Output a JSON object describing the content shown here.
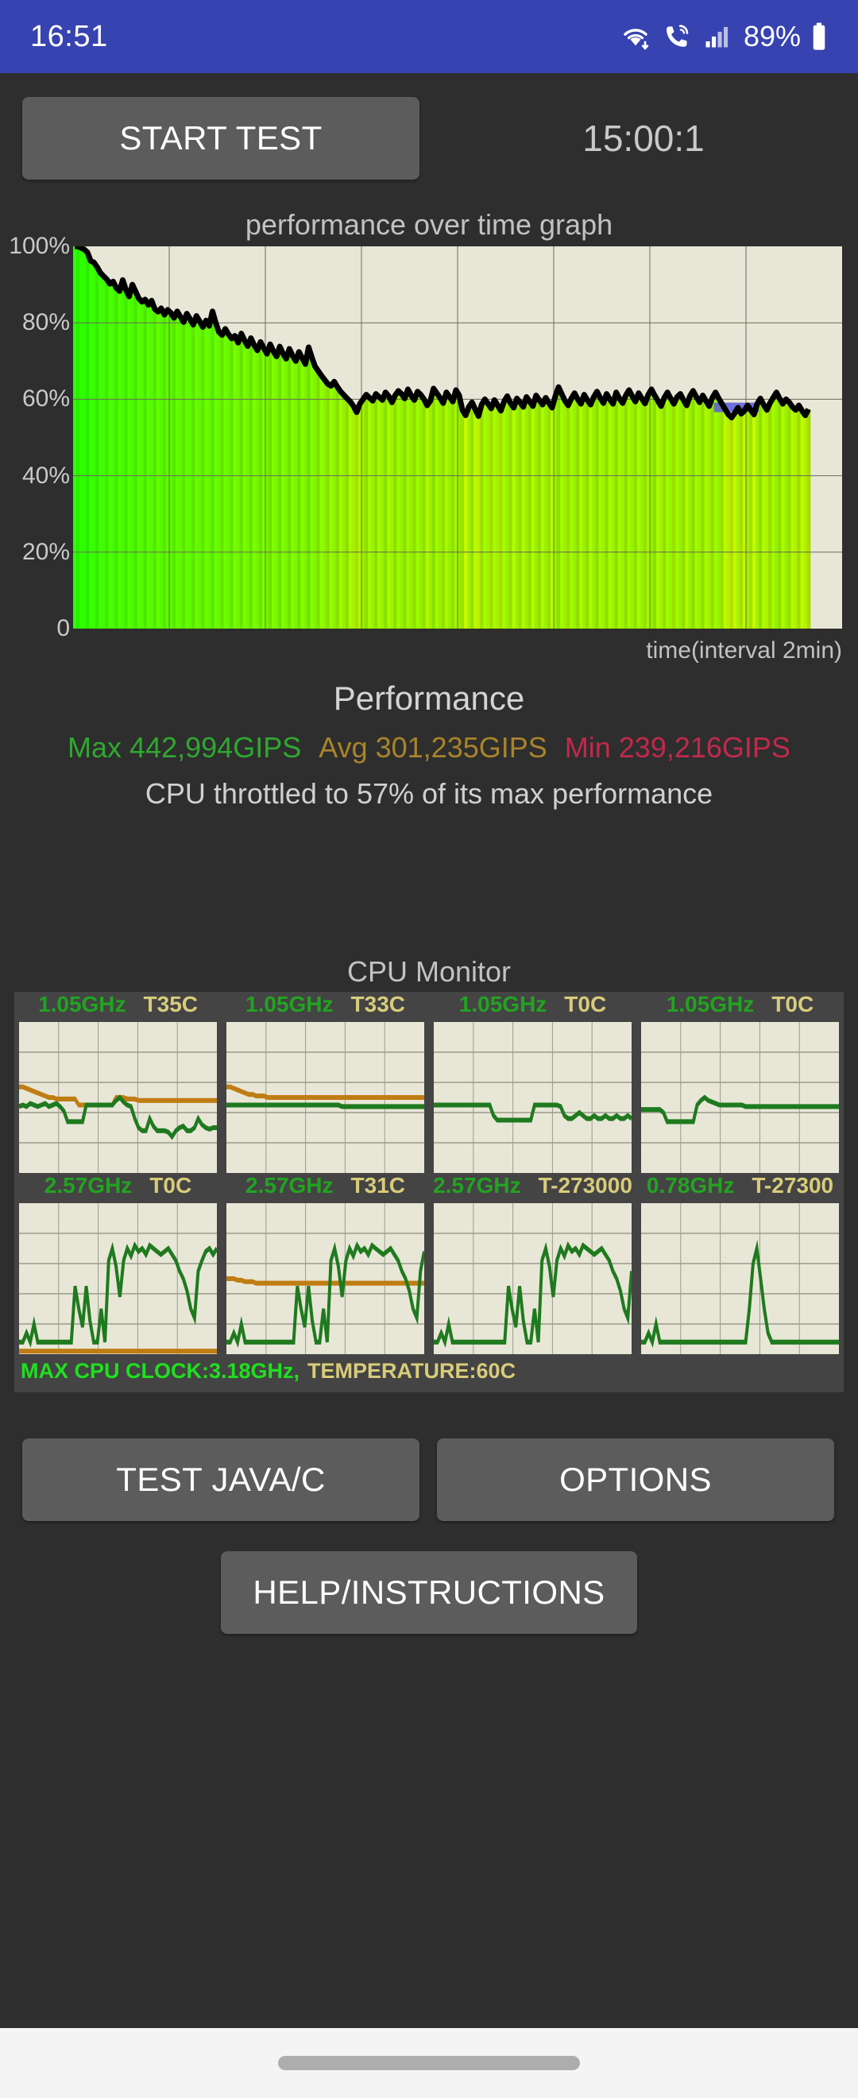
{
  "statusbar": {
    "time": "16:51",
    "battery_percent": "89%",
    "icons": [
      "wifi-icon",
      "call-signal-icon",
      "cellular-signal-icon",
      "battery-icon"
    ]
  },
  "toolbar": {
    "start_test_label": "START TEST",
    "timer": "15:00:1"
  },
  "main_chart": {
    "title": "performance over time graph",
    "xlabel": "time(interval 2min)",
    "yticks": [
      "100%",
      "80%",
      "60%",
      "40%",
      "20%",
      "0"
    ]
  },
  "performance": {
    "title": "Performance",
    "max_label": "Max 442,994GIPS",
    "avg_label": "Avg 301,235GIPS",
    "min_label": "Min 239,216GIPS",
    "max_color": "#2fa82f",
    "avg_color": "#a8842a",
    "min_color": "#c2294b",
    "throttle_text": "CPU throttled to 57% of its max performance"
  },
  "cpu_monitor": {
    "title": "CPU Monitor",
    "cells": [
      {
        "clock": "1.05GHz",
        "temp": "T35C"
      },
      {
        "clock": "1.05GHz",
        "temp": "T33C"
      },
      {
        "clock": "1.05GHz",
        "temp": "T0C"
      },
      {
        "clock": "1.05GHz",
        "temp": "T0C"
      },
      {
        "clock": "2.57GHz",
        "temp": "T0C"
      },
      {
        "clock": "2.57GHz",
        "temp": "T31C"
      },
      {
        "clock": "2.57GHz",
        "temp": "T-273000"
      },
      {
        "clock": "0.78GHz",
        "temp": "T-27300"
      }
    ],
    "footer_clock": "MAX CPU CLOCK:3.18GHz,",
    "footer_temp": "TEMPERATURE:60C"
  },
  "buttons": {
    "test_java_c": "TEST JAVA/C",
    "options": "OPTIONS",
    "help": "HELP/INSTRUCTIONS"
  },
  "navbar": {
    "gesture_pill": "home-gesture-pill"
  },
  "chart_data": {
    "type": "area",
    "title": "performance over time graph",
    "xlabel": "time(interval 2min)",
    "ylabel": "",
    "ylim": [
      0,
      100
    ],
    "grid": true,
    "legend": "none",
    "x_interval_minutes": 2,
    "units": "percent of max performance",
    "fill_gradient_stops": [
      {
        "pct": 0,
        "color": "#2bff00"
      },
      {
        "pct": 40,
        "color": "#9bf000"
      },
      {
        "pct": 52,
        "color": "#f5ee00"
      },
      {
        "pct": 58,
        "color": "#ff9000"
      },
      {
        "pct": 100,
        "color": "#ff3d00"
      }
    ],
    "line_color": "#000000",
    "highlight_color": "#5b5bdd",
    "values": [
      100,
      100,
      99.6,
      99.2,
      98.4,
      96.2,
      95.8,
      94.6,
      93.1,
      92.2,
      91.4,
      90.2,
      90.8,
      89.1,
      88.3,
      91.2,
      88.6,
      86.9,
      90.0,
      88.2,
      86.4,
      85.5,
      86.1,
      84.7,
      85.8,
      83.6,
      82.9,
      83.8,
      82.1,
      83.4,
      82.6,
      81.3,
      83.0,
      81.6,
      80.2,
      82.4,
      81.0,
      79.5,
      81.8,
      80.4,
      78.9,
      80.6,
      79.2,
      83.0,
      80.1,
      77.6,
      76.8,
      78.4,
      77.0,
      75.9,
      76.6,
      74.8,
      77.2,
      75.4,
      73.9,
      76.0,
      74.2,
      72.8,
      75.0,
      73.4,
      71.9,
      74.4,
      72.6,
      71.2,
      73.8,
      72.0,
      70.6,
      73.2,
      71.4,
      70.0,
      72.4,
      70.8,
      69.2,
      73.6,
      71.0,
      68.6,
      67.4,
      66.2,
      65.1,
      64.0,
      63.5,
      64.6,
      63.2,
      62.0,
      61.1,
      60.2,
      59.4,
      58.2,
      56.6,
      58.8,
      60.0,
      61.2,
      60.4,
      59.6,
      61.4,
      60.6,
      59.8,
      61.8,
      60.8,
      59.2,
      61.0,
      62.2,
      61.4,
      60.2,
      62.6,
      61.0,
      59.8,
      62.0,
      61.2,
      60.0,
      58.4,
      59.6,
      62.8,
      61.6,
      60.4,
      59.0,
      61.8,
      60.6,
      59.4,
      62.4,
      61.0,
      57.2,
      55.8,
      58.0,
      59.2,
      57.4,
      55.6,
      58.6,
      60.0,
      58.8,
      57.6,
      59.8,
      58.4,
      57.0,
      59.4,
      60.8,
      59.0,
      57.8,
      60.2,
      59.2,
      58.0,
      60.6,
      59.4,
      58.2,
      61.0,
      59.8,
      58.6,
      60.4,
      59.0,
      57.8,
      60.8,
      63.2,
      61.4,
      59.6,
      58.4,
      60.2,
      61.6,
      60.0,
      58.8,
      61.2,
      59.8,
      58.6,
      60.6,
      62.0,
      60.4,
      59.0,
      61.4,
      60.0,
      58.8,
      61.8,
      60.2,
      59.0,
      61.0,
      62.4,
      60.8,
      59.4,
      61.6,
      60.2,
      58.9,
      61.2,
      62.6,
      61.0,
      59.6,
      58.2,
      60.4,
      61.8,
      60.2,
      58.8,
      60.6,
      61.4,
      59.8,
      58.4,
      60.8,
      62.2,
      60.6,
      59.2,
      61.0,
      59.6,
      58.2,
      60.4,
      61.8,
      60.2,
      58.8,
      57.4,
      56.0,
      55.2,
      56.4,
      57.8,
      56.2,
      57.0,
      58.4,
      57.2,
      56.0,
      58.8,
      60.2,
      58.6,
      57.2,
      59.0,
      60.4,
      61.8,
      60.2,
      58.8,
      60.0,
      59.2,
      58.0,
      57.2,
      58.4,
      57.0,
      55.8,
      57.4
    ],
    "highlight_range": [
      200,
      214
    ],
    "highlight_value": 58.5
  },
  "cpu_mini_charts": [
    {
      "clock_series": [
        44,
        45,
        44,
        46,
        45,
        44,
        45,
        46,
        44,
        45,
        46,
        44,
        41,
        34,
        34,
        34,
        34,
        34,
        45,
        45,
        45,
        45,
        45,
        45,
        45,
        45,
        48,
        50,
        47,
        45,
        44,
        36,
        30,
        28,
        28,
        36,
        31,
        28,
        28,
        28,
        27,
        24,
        28,
        30,
        31,
        28,
        28,
        30,
        36,
        32,
        30,
        29,
        30,
        30
      ],
      "temp_series": [
        57,
        57,
        56,
        55,
        54,
        53,
        52,
        51,
        50,
        50,
        49,
        49,
        49,
        49,
        49,
        49,
        45,
        45,
        45,
        45,
        45,
        45,
        45,
        45,
        45,
        45,
        50,
        50,
        50,
        49,
        49,
        49,
        48,
        48,
        48,
        48,
        48,
        48,
        48,
        48,
        48,
        48,
        48,
        48,
        48,
        48,
        48,
        48,
        48,
        48,
        48,
        48,
        48,
        48
      ]
    },
    {
      "clock_series": [
        45,
        45,
        45,
        45,
        45,
        45,
        45,
        45,
        45,
        45,
        45,
        45,
        45,
        45,
        45,
        45,
        45,
        45,
        45,
        45,
        45,
        45,
        45,
        45,
        45,
        45,
        45,
        45,
        45,
        45,
        45,
        44,
        44,
        44,
        44,
        44,
        44,
        44,
        44,
        44,
        44,
        44,
        44,
        44,
        44,
        44,
        44,
        44,
        44,
        44,
        44,
        44,
        44,
        44
      ],
      "temp_series": [
        57,
        57,
        56,
        55,
        54,
        53,
        52,
        52,
        51,
        51,
        51,
        50,
        50,
        50,
        50,
        50,
        50,
        50,
        50,
        50,
        50,
        50,
        50,
        50,
        50,
        50,
        50,
        50,
        50,
        50,
        50,
        50,
        50,
        50,
        50,
        50,
        50,
        50,
        50,
        50,
        50,
        50,
        50,
        50,
        50,
        50,
        50,
        50,
        50,
        50,
        50,
        50,
        50,
        50
      ]
    },
    {
      "clock_series": [
        45,
        45,
        45,
        45,
        45,
        45,
        45,
        45,
        45,
        45,
        45,
        45,
        45,
        45,
        45,
        45,
        38,
        35,
        35,
        35,
        35,
        35,
        35,
        35,
        35,
        35,
        35,
        45,
        45,
        45,
        45,
        45,
        45,
        45,
        44,
        38,
        36,
        36,
        38,
        40,
        38,
        36,
        36,
        38,
        36,
        36,
        38,
        36,
        36,
        38,
        36,
        36,
        38,
        36
      ],
      "temp_series": null
    },
    {
      "clock_series": [
        42,
        42,
        42,
        42,
        42,
        42,
        40,
        34,
        34,
        34,
        34,
        34,
        34,
        34,
        34,
        45,
        48,
        50,
        48,
        47,
        46,
        45,
        45,
        45,
        45,
        45,
        45,
        45,
        44,
        44,
        44,
        44,
        44,
        44,
        44,
        44,
        44,
        44,
        44,
        44,
        44,
        44,
        44,
        44,
        44,
        44,
        44,
        44,
        44,
        44,
        44,
        44,
        44,
        44
      ],
      "temp_series": null
    },
    {
      "clock_series": [
        8,
        8,
        14,
        8,
        20,
        8,
        8,
        8,
        8,
        8,
        8,
        8,
        8,
        8,
        8,
        45,
        30,
        18,
        45,
        22,
        8,
        8,
        30,
        8,
        62,
        70,
        58,
        38,
        62,
        70,
        65,
        72,
        68,
        70,
        66,
        72,
        70,
        68,
        66,
        68,
        70,
        66,
        62,
        55,
        50,
        42,
        30,
        24,
        55,
        62,
        68,
        70,
        66,
        70
      ],
      "temp_series": [
        2,
        2,
        2,
        2,
        2,
        2,
        2,
        2,
        2,
        2,
        2,
        2,
        2,
        2,
        2,
        2,
        2,
        2,
        2,
        2,
        2,
        2,
        2,
        2,
        2,
        2,
        2,
        2,
        2,
        2,
        2,
        2,
        2,
        2,
        2,
        2,
        2,
        2,
        2,
        2,
        2,
        2,
        2,
        2,
        2,
        2,
        2,
        2,
        2,
        2,
        2,
        2,
        2,
        2
      ]
    },
    {
      "clock_series": [
        8,
        8,
        14,
        8,
        20,
        8,
        8,
        8,
        8,
        8,
        8,
        8,
        8,
        8,
        8,
        8,
        8,
        8,
        8,
        45,
        30,
        18,
        45,
        22,
        8,
        8,
        30,
        8,
        62,
        70,
        58,
        38,
        62,
        70,
        65,
        72,
        68,
        70,
        66,
        72,
        70,
        68,
        66,
        68,
        70,
        66,
        62,
        55,
        50,
        42,
        30,
        24,
        55,
        68
      ],
      "temp_series": [
        50,
        50,
        50,
        49,
        49,
        48,
        48,
        48,
        47,
        47,
        47,
        47,
        47,
        47,
        47,
        47,
        47,
        47,
        47,
        47,
        47,
        47,
        47,
        47,
        47,
        47,
        47,
        47,
        47,
        47,
        47,
        47,
        47,
        47,
        47,
        47,
        47,
        47,
        47,
        47,
        47,
        47,
        47,
        47,
        47,
        47,
        47,
        47,
        47,
        47,
        47,
        47,
        47,
        47
      ]
    },
    {
      "clock_series": [
        8,
        8,
        14,
        8,
        20,
        8,
        8,
        8,
        8,
        8,
        8,
        8,
        8,
        8,
        8,
        8,
        8,
        8,
        8,
        8,
        45,
        30,
        18,
        45,
        22,
        8,
        8,
        30,
        8,
        62,
        70,
        58,
        38,
        62,
        70,
        65,
        72,
        68,
        70,
        66,
        72,
        70,
        68,
        66,
        68,
        70,
        66,
        62,
        55,
        50,
        42,
        30,
        24,
        55
      ],
      "temp_series": null
    },
    {
      "clock_series": [
        8,
        8,
        14,
        8,
        20,
        8,
        8,
        8,
        8,
        8,
        8,
        8,
        8,
        8,
        8,
        8,
        8,
        8,
        8,
        8,
        8,
        8,
        8,
        8,
        8,
        8,
        8,
        8,
        8,
        30,
        60,
        70,
        50,
        30,
        14,
        8,
        8,
        8,
        8,
        8,
        8,
        8,
        8,
        8,
        8,
        8,
        8,
        8,
        8,
        8,
        8,
        8,
        8,
        8
      ],
      "temp_series": null
    }
  ]
}
